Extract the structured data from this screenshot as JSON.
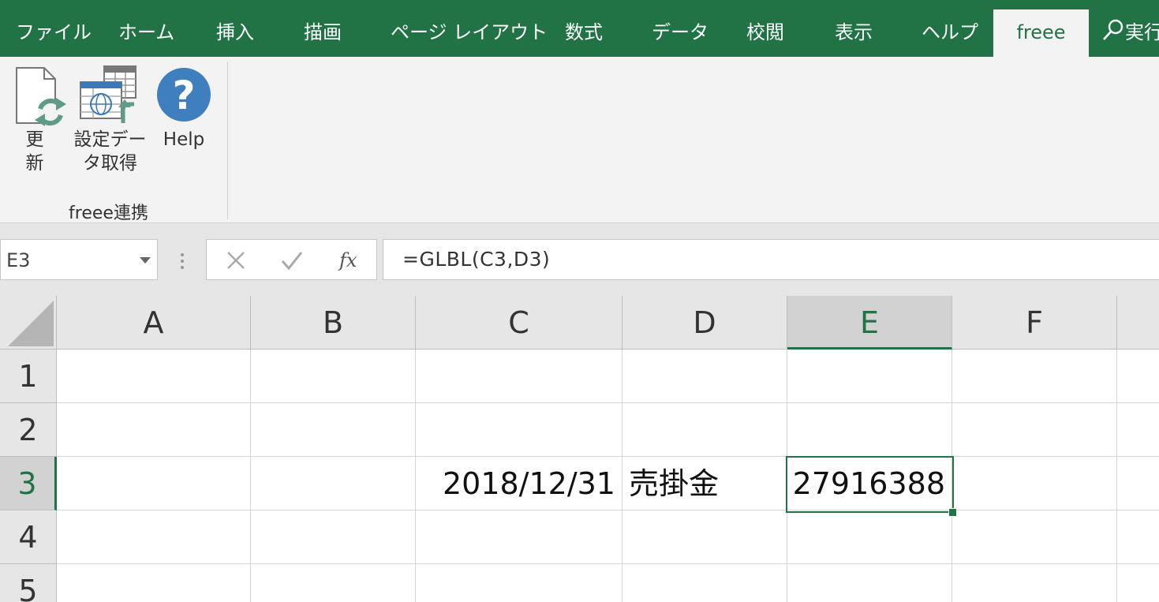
{
  "ribbon": {
    "tabs": [
      "ファイル",
      "ホーム",
      "挿入",
      "描画",
      "ページ レイアウト",
      "数式",
      "データ",
      "校閲",
      "表示",
      "ヘルプ",
      "freee"
    ],
    "active_tab": "freee",
    "search_label": "実行"
  },
  "freee_group": {
    "buttons": [
      "更新",
      "設定データ取得",
      "Help"
    ],
    "update_line1": "更",
    "update_line2": "新",
    "settings_line1": "設定デー",
    "settings_line2": "タ取得",
    "help_label": "Help",
    "group_label": "freee連携"
  },
  "formula_bar": {
    "name_box": "E3",
    "formula": "=GLBL(C3,D3)"
  },
  "sheet": {
    "columns": [
      "A",
      "B",
      "C",
      "D",
      "E",
      "F"
    ],
    "rows": [
      "1",
      "2",
      "3",
      "4",
      "5"
    ],
    "selected_column": "E",
    "selected_row": "3",
    "cells": {
      "C3": "2018/12/31",
      "D3": "売掛金",
      "E3": "27916388"
    }
  }
}
